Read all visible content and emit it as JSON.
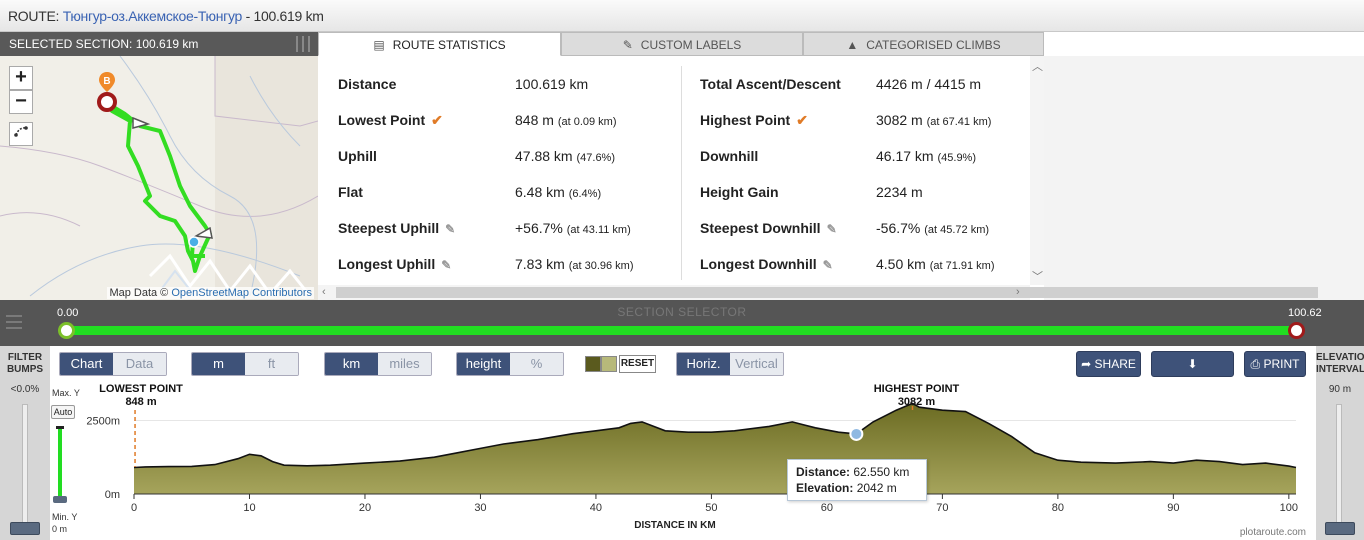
{
  "title": {
    "prefix": "ROUTE:",
    "name": "Тюнгур-оз.Аккемское-Тюнгур",
    "distance": "- 100.619 km"
  },
  "selected_section": "SELECTED SECTION: 100.619 km",
  "map": {
    "zoom_in": "+",
    "zoom_out": "−",
    "attribution_prefix": "Map Data ©",
    "attribution_link": "OpenStreetMap Contributors",
    "marker_b": "B"
  },
  "tabs": [
    {
      "label": "ROUTE STATISTICS",
      "icon": "list-icon",
      "active": true
    },
    {
      "label": "CUSTOM LABELS",
      "icon": "pencil-icon",
      "active": false
    },
    {
      "label": "CATEGORISED CLIMBS",
      "icon": "mountain-icon",
      "active": false
    }
  ],
  "stats": {
    "distance": {
      "label": "Distance",
      "value": "100.619 km"
    },
    "lowest": {
      "label": "Lowest Point",
      "value": "848 m",
      "at": "(at 0.09 km)"
    },
    "uphill": {
      "label": "Uphill",
      "value": "47.88 km",
      "at": "(47.6%)"
    },
    "flat": {
      "label": "Flat",
      "value": "6.48 km",
      "at": "(6.4%)"
    },
    "steep_up": {
      "label": "Steepest Uphill",
      "value": "+56.7%",
      "at": "(at 43.11 km)"
    },
    "long_up": {
      "label": "Longest Uphill",
      "value": "7.83 km",
      "at": "(at 30.96 km)"
    },
    "ascent": {
      "label": "Total Ascent/Descent",
      "value": "4426 m / 4415 m"
    },
    "highest": {
      "label": "Highest Point",
      "value": "3082 m",
      "at": "(at 67.41 km)"
    },
    "downhill": {
      "label": "Downhill",
      "value": "46.17 km",
      "at": "(45.9%)"
    },
    "gain": {
      "label": "Height Gain",
      "value": "2234 m"
    },
    "steep_down": {
      "label": "Steepest Downhill",
      "value": "-56.7%",
      "at": "(at 45.72 km)"
    },
    "long_down": {
      "label": "Longest Downhill",
      "value": "4.50 km",
      "at": "(at 71.91 km)"
    }
  },
  "section_selector": {
    "title": "SECTION SELECTOR",
    "start": "0.00",
    "end": "100.62"
  },
  "left_panel": {
    "title1": "FILTER",
    "title2": "BUMPS",
    "value": "<0.0%"
  },
  "right_panel": {
    "title1": "ELEVATION",
    "title2": "INTERVAL",
    "value": "90 m"
  },
  "toolbar": {
    "chart": "Chart",
    "data": "Data",
    "m": "m",
    "ft": "ft",
    "km": "km",
    "miles": "miles",
    "height": "height",
    "percent": "%",
    "reset": "RESET",
    "horiz": "Horiz.",
    "vertical": "Vertical",
    "share": "SHARE",
    "download": "DOWNLOAD",
    "print": "PRINT",
    "swatch1": "#5a5a1e",
    "swatch2": "#b7b97a"
  },
  "yaxis": {
    "max_label": "Max. Y",
    "auto": "Auto",
    "min_label": "Min. Y",
    "min_value": "0 m"
  },
  "tooltip": {
    "dist_label": "Distance:",
    "dist_value": "62.550 km",
    "elev_label": "Elevation:",
    "elev_value": "2042 m"
  },
  "credit": "plotaroute.com",
  "chart_data": {
    "type": "area",
    "title": "",
    "xlabel": "DISTANCE IN KM",
    "ylabel": "",
    "xlim": [
      0,
      100.62
    ],
    "ylim": [
      0,
      3400
    ],
    "xticks": [
      0,
      10,
      20,
      30,
      40,
      50,
      60,
      70,
      80,
      90,
      100
    ],
    "yticks": [
      {
        "value": 0,
        "label": "0m"
      },
      {
        "value": 2500,
        "label": "2500m"
      }
    ],
    "fill": "#5a5a1e",
    "x": [
      0,
      1,
      3,
      5,
      7,
      9,
      10,
      11,
      12,
      13,
      15,
      17,
      20,
      23,
      26,
      28,
      30,
      32,
      35,
      38,
      40,
      42,
      43,
      44,
      45,
      46,
      48,
      50,
      52,
      55,
      57,
      58,
      59,
      61,
      62.55,
      64,
      66,
      67.41,
      68,
      70,
      72,
      74,
      76,
      78,
      80,
      82,
      85,
      88,
      90,
      92,
      94,
      96,
      98,
      100,
      100.62
    ],
    "y": [
      900,
      920,
      930,
      940,
      1000,
      1200,
      1350,
      1300,
      1100,
      980,
      960,
      980,
      1050,
      1120,
      1250,
      1400,
      1550,
      1700,
      1850,
      2050,
      2150,
      2250,
      2400,
      2450,
      2300,
      2150,
      2100,
      2100,
      2150,
      2300,
      2450,
      2350,
      2250,
      2100,
      2042,
      2450,
      2850,
      3082,
      2950,
      2850,
      2800,
      2400,
      1950,
      1400,
      1150,
      1080,
      1050,
      1100,
      1050,
      1150,
      1100,
      1000,
      1050,
      950,
      900
    ],
    "annotations": [
      {
        "label": "LOWEST POINT",
        "value": "848 m",
        "x": 0.09
      },
      {
        "label": "HIGHEST POINT",
        "value": "3082 m",
        "x": 67.41
      }
    ],
    "marker": {
      "x": 62.55,
      "y": 2042
    }
  }
}
